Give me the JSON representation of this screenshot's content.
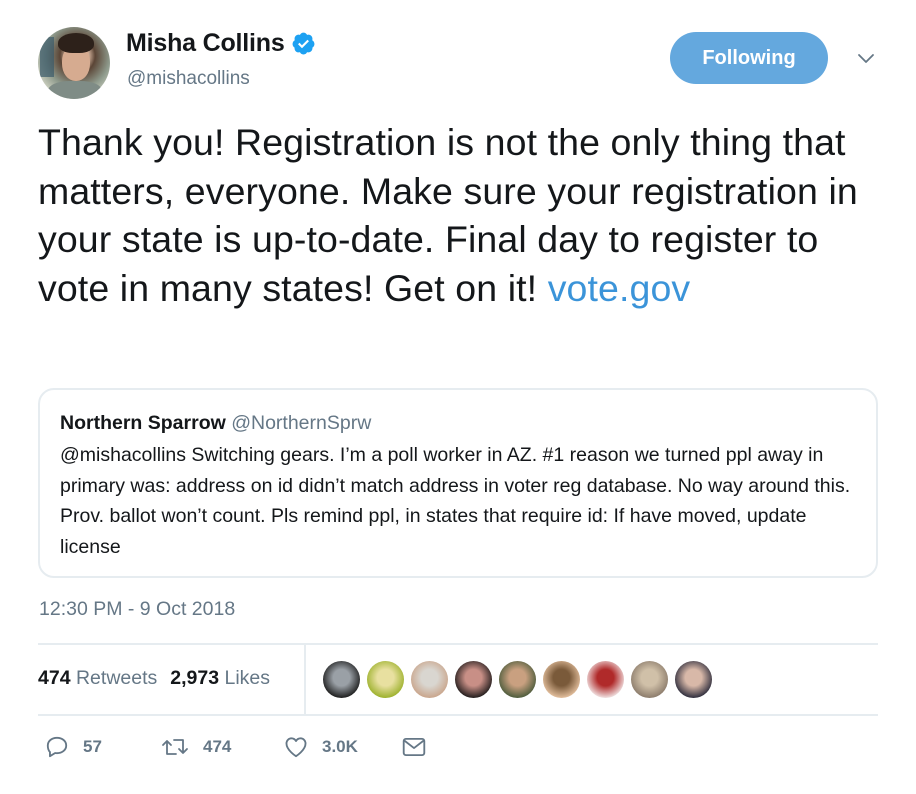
{
  "author": {
    "name": "Misha Collins",
    "handle": "@mishacollins",
    "verified": true,
    "avatar_icon": "profile-photo"
  },
  "follow_button": {
    "label": "Following",
    "color": "#64a8de"
  },
  "menu_icon": "chevron-down-icon",
  "tweet": {
    "text": "Thank you! Registration is not the only thing that matters, everyone. Make sure your registration in your state is up-to-date. Final day to register to vote in many states! Get on it! ",
    "link": "vote.gov",
    "link_color": "#3b94d9"
  },
  "quoted_tweet": {
    "name": "Northern Sparrow",
    "handle": "@NorthernSprw",
    "text": "@mishacollins Switching gears. I’m a poll worker in AZ. #1 reason we turned ppl away in primary was: address on id didn’t match address in voter reg database. No way around this. Prov. ballot won’t count. Pls remind ppl, in states that require id: If have moved, update license"
  },
  "timestamp": "12:30 PM - 9 Oct 2018",
  "stats": {
    "retweets_count": "474",
    "retweets_label": "Retweets",
    "likes_count": "2,973",
    "likes_label": "Likes"
  },
  "likers": [
    {
      "name": "liker-1",
      "colors": [
        "#1a1a1a",
        "#9aa0a6"
      ]
    },
    {
      "name": "liker-2",
      "colors": [
        "#9bb02a",
        "#e8e0a0"
      ]
    },
    {
      "name": "liker-3",
      "colors": [
        "#c9a48a",
        "#d9d6d0"
      ]
    },
    {
      "name": "liker-4",
      "colors": [
        "#1e1a1a",
        "#c88f86"
      ]
    },
    {
      "name": "liker-5",
      "colors": [
        "#4a5a3a",
        "#c9a080"
      ]
    },
    {
      "name": "liker-6",
      "colors": [
        "#e6c2a0",
        "#7a5a3a"
      ]
    },
    {
      "name": "liker-7",
      "colors": [
        "#f2e6e6",
        "#b02a2a"
      ]
    },
    {
      "name": "liker-8",
      "colors": [
        "#8a7a6a",
        "#d0c0a8"
      ]
    },
    {
      "name": "liker-9",
      "colors": [
        "#2a2a3a",
        "#d8b8a8"
      ]
    }
  ],
  "actions": {
    "reply": {
      "icon": "reply-icon",
      "count": "57"
    },
    "retweet": {
      "icon": "retweet-icon",
      "count": "474"
    },
    "like": {
      "icon": "heart-icon",
      "count": "3.0K"
    },
    "message": {
      "icon": "envelope-icon"
    }
  }
}
